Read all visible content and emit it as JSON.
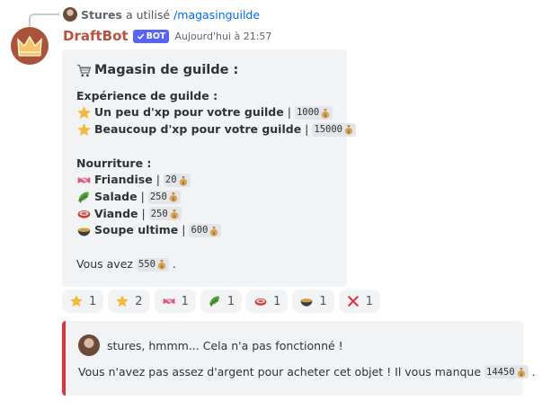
{
  "reply": {
    "user": "Stures",
    "text": "a utilisé",
    "command": "/magasinguilde"
  },
  "message": {
    "username": "DraftBot",
    "bot_tag": "BOT",
    "timestamp": "Aujourd'hui à 21:57"
  },
  "embed": {
    "title": "Magasin de guilde :",
    "sections": {
      "xp": {
        "heading": "Expérience de guilde :",
        "items": [
          {
            "icon": "star-icon",
            "label": "Un peu d'xp pour votre guilde",
            "price": "1000"
          },
          {
            "icon": "star-icon",
            "label": "Beaucoup d'xp pour votre guilde",
            "price": "15000"
          }
        ]
      },
      "food": {
        "heading": "Nourriture :",
        "items": [
          {
            "icon": "candy-icon",
            "label": "Friandise",
            "price": "20"
          },
          {
            "icon": "salad-icon",
            "label": "Salade",
            "price": "250"
          },
          {
            "icon": "meat-icon",
            "label": "Viande",
            "price": "250"
          },
          {
            "icon": "soup-icon",
            "label": "Soupe ultime",
            "price": "600"
          }
        ]
      }
    },
    "balance_prefix": "Vous avez",
    "balance": "550",
    "balance_suffix": "."
  },
  "reactions": [
    {
      "icon": "star-icon",
      "count": "1"
    },
    {
      "icon": "star-icon",
      "count": "2"
    },
    {
      "icon": "candy-icon",
      "count": "1"
    },
    {
      "icon": "salad-icon",
      "count": "1"
    },
    {
      "icon": "meat-icon",
      "count": "1"
    },
    {
      "icon": "soup-icon",
      "count": "1"
    },
    {
      "icon": "cross-icon",
      "count": "1"
    }
  ],
  "error_embed": {
    "author": "stures, hmmm... Cela n'a pas fonctionné !",
    "description": "Vous n'avez pas assez d'argent pour acheter cet objet ! Il vous manque",
    "missing": "14450",
    "suffix": ".",
    "accent": "#da373c"
  },
  "colors": {
    "brand": "#b8523e",
    "bot_tag": "#5865f2",
    "link": "#006ce7"
  }
}
